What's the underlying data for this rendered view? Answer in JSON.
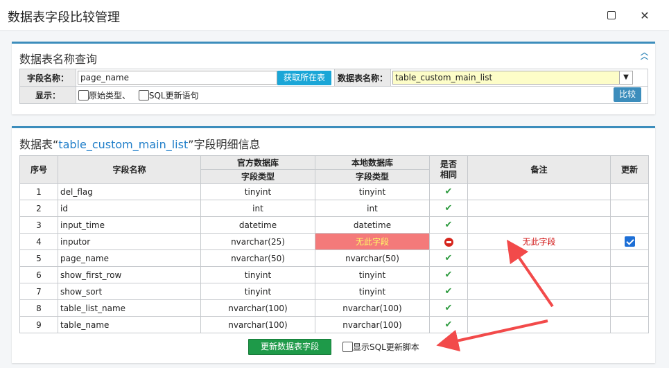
{
  "window": {
    "title": "数据表字段比较管理"
  },
  "query_panel": {
    "title": "数据表名称查询",
    "field_name_label": "字段名称：",
    "field_name_value": "page_name",
    "get_table_button": "获取所在表",
    "table_name_label": "数据表名称：",
    "table_name_value": "table_custom_main_list",
    "display_label": "显示：",
    "option_raw_type": "原始类型、",
    "option_sql_statement": "SQL更新语句",
    "compare_button": "比较"
  },
  "detail_panel": {
    "title_prefix": "数据表“",
    "table_name": "table_custom_main_list",
    "title_suffix": "”字段明细信息",
    "headers": {
      "index": "序号",
      "field_name": "字段名称",
      "official_db": "官方数据库",
      "local_db": "本地数据库",
      "field_type_official": "字段类型",
      "field_type_local": "字段类型",
      "same": "是否相同",
      "note": "备注",
      "update": "更新"
    },
    "rows": [
      {
        "index": "1",
        "field": "del_flag",
        "official": "tinyint",
        "local": "tinyint",
        "same": true,
        "note": "",
        "update": null
      },
      {
        "index": "2",
        "field": "id",
        "official": "int",
        "local": "int",
        "same": true,
        "note": "",
        "update": null
      },
      {
        "index": "3",
        "field": "input_time",
        "official": "datetime",
        "local": "datetime",
        "same": true,
        "note": "",
        "update": null
      },
      {
        "index": "4",
        "field": "inputor",
        "official": "nvarchar(25)",
        "local": "无此字段",
        "same": false,
        "note": "无此字段",
        "update": true
      },
      {
        "index": "5",
        "field": "page_name",
        "official": "nvarchar(50)",
        "local": "nvarchar(50)",
        "same": true,
        "note": "",
        "update": null
      },
      {
        "index": "6",
        "field": "show_first_row",
        "official": "tinyint",
        "local": "tinyint",
        "same": true,
        "note": "",
        "update": null
      },
      {
        "index": "7",
        "field": "show_sort",
        "official": "tinyint",
        "local": "tinyint",
        "same": true,
        "note": "",
        "update": null
      },
      {
        "index": "8",
        "field": "table_list_name",
        "official": "nvarchar(100)",
        "local": "nvarchar(100)",
        "same": true,
        "note": "",
        "update": null
      },
      {
        "index": "9",
        "field": "table_name",
        "official": "nvarchar(100)",
        "local": "nvarchar(100)",
        "same": true,
        "note": "",
        "update": null
      }
    ],
    "update_button": "更新数据表字段",
    "show_sql_label": "显示SQL更新脚本"
  },
  "colors": {
    "accent": "#3c8dbc",
    "missing_bg": "#f47a7a",
    "missing_text": "#ffff66",
    "note_text": "#d01010",
    "update_button": "#1e9a49",
    "annotation_arrow": "#f24a4a"
  }
}
